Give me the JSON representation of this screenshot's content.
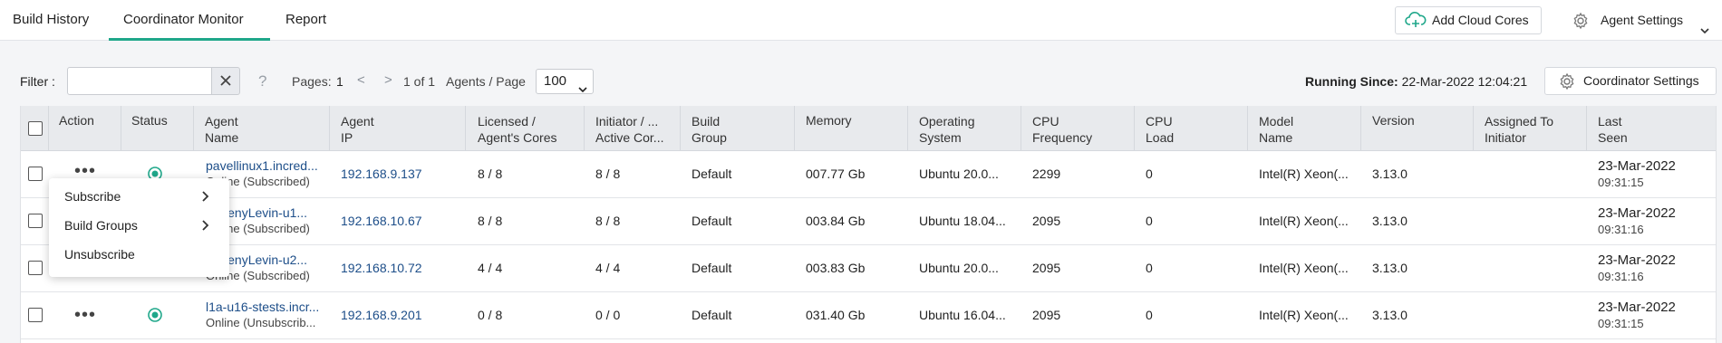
{
  "nav": {
    "tabs": [
      "Build History",
      "Coordinator Monitor",
      "Report"
    ],
    "active_tab": "Coordinator Monitor",
    "add_cloud_cores": "Add Cloud Cores",
    "agent_settings": "Agent Settings"
  },
  "toolbar": {
    "filter_label": "Filter :",
    "filter_value": "",
    "help": "?",
    "pages_label": "Pages:",
    "current_page": "1",
    "prev": "<",
    "next": ">",
    "page_of": "1 of 1",
    "agents_per_page_label": "Agents / Page",
    "agents_per_page": "100",
    "running_since_label": "Running Since:",
    "running_since_value": "22-Mar-2022 12:04:21",
    "coordinator_settings": "Coordinator Settings"
  },
  "table": {
    "headers": {
      "action": "Action",
      "status": "Status",
      "agent_name": "Agent\nName",
      "agent_ip": "Agent\nIP",
      "licensed": "Licensed /\nAgent's Cores",
      "initiator": "Initiator / ...\nActive Cor...",
      "build_group": "Build\nGroup",
      "memory": "Memory",
      "os": "Operating\nSystem",
      "cpu_freq": "CPU\nFrequency",
      "cpu_load": "CPU\nLoad",
      "model": "Model\nName",
      "version": "Version",
      "assigned": "Assigned To\nInitiator",
      "last_seen": "Last\nSeen"
    },
    "rows": [
      {
        "name": "pavellinux1.incred...",
        "state": "Online (Subscribed)",
        "ip": "192.168.9.137",
        "licensed": "8 / 8",
        "initiator": "8 / 8",
        "group": "Default",
        "memory": "007.77 Gb",
        "os": "Ubuntu 20.0...",
        "freq": "2299",
        "load": "0",
        "model": "Intel(R) Xeon(...",
        "version": "3.13.0",
        "assigned": "",
        "date": "23-Mar-2022",
        "time": "09:31:15"
      },
      {
        "name": "EvgenyLevin-u1...",
        "state": "Online (Subscribed)",
        "ip": "192.168.10.67",
        "licensed": "8 / 8",
        "initiator": "8 / 8",
        "group": "Default",
        "memory": "003.84 Gb",
        "os": "Ubuntu 18.04...",
        "freq": "2095",
        "load": "0",
        "model": "Intel(R) Xeon(...",
        "version": "3.13.0",
        "assigned": "",
        "date": "23-Mar-2022",
        "time": "09:31:16"
      },
      {
        "name": "EvgenyLevin-u2...",
        "state": "Online (Subscribed)",
        "ip": "192.168.10.72",
        "licensed": "4 / 4",
        "initiator": "4 / 4",
        "group": "Default",
        "memory": "003.83 Gb",
        "os": "Ubuntu 20.0...",
        "freq": "2095",
        "load": "0",
        "model": "Intel(R) Xeon(...",
        "version": "3.13.0",
        "assigned": "",
        "date": "23-Mar-2022",
        "time": "09:31:16"
      },
      {
        "name": "l1a-u16-stests.incr...",
        "state": "Online (Unsubscrib...",
        "ip": "192.168.9.201",
        "licensed": "0 / 8",
        "initiator": "0 / 0",
        "group": "Default",
        "memory": "031.40 Gb",
        "os": "Ubuntu 16.04...",
        "freq": "2095",
        "load": "0",
        "model": "Intel(R) Xeon(...",
        "version": "3.13.0",
        "assigned": "",
        "date": "23-Mar-2022",
        "time": "09:31:15"
      }
    ]
  },
  "context_menu": {
    "items": [
      "Subscribe",
      "Build Groups",
      "Unsubscribe"
    ]
  },
  "colors": {
    "accent": "#1fa78a",
    "link": "#1d4e89",
    "header_bg": "#e8eaed"
  }
}
